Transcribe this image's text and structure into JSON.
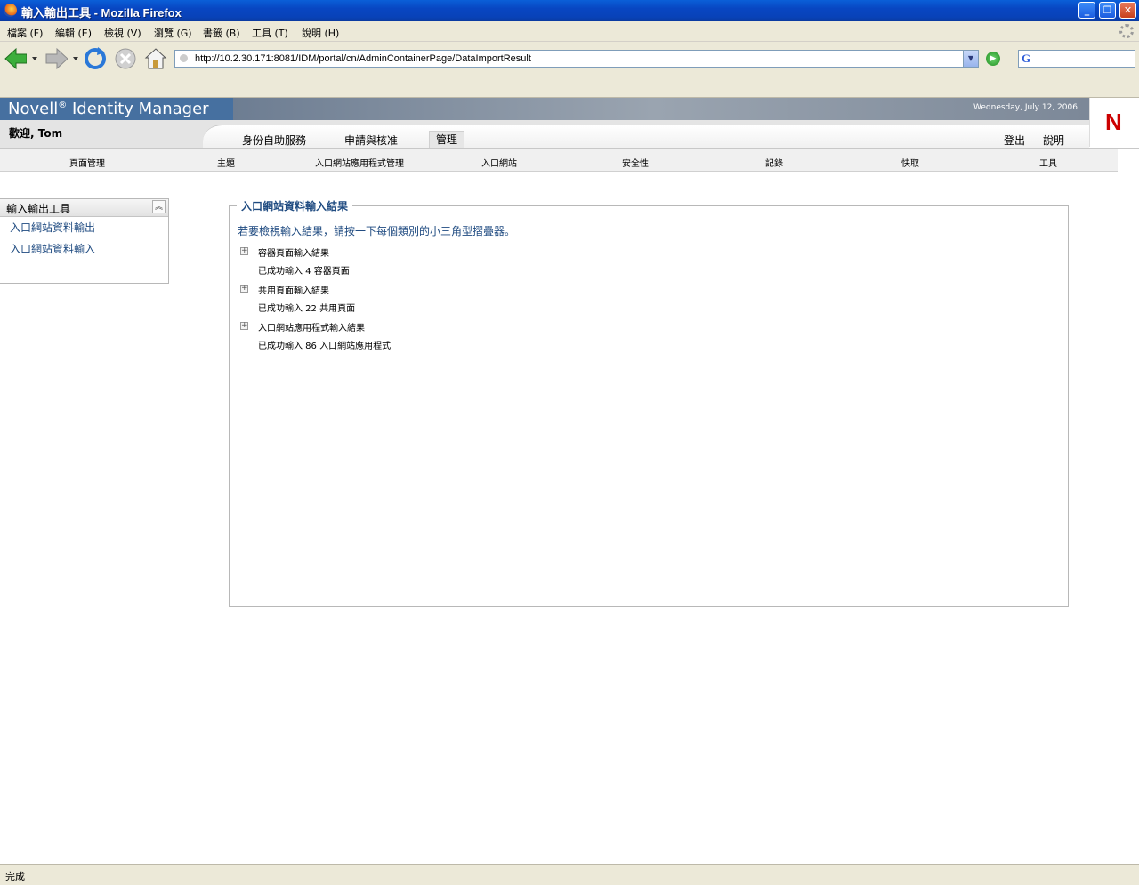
{
  "window": {
    "title": "輸入輸出工具 - Mozilla Firefox",
    "minimize": "_",
    "maximize": "❐",
    "close": "✕"
  },
  "menu": [
    "檔案 (F)",
    "編輯 (E)",
    "檢視 (V)",
    "瀏覽 (G)",
    "書籤 (B)",
    "工具 (T)",
    "說明 (H)"
  ],
  "toolbar": {
    "url": "http://10.2.30.171:8081/IDM/portal/cn/AdminContainerPage/DataImportResult",
    "url_dropdown": "▼",
    "go": "▶",
    "search_engine": "G"
  },
  "header": {
    "brand": "Novell",
    "brand_mark": "®",
    "product": "Identity Manager",
    "date": "Wednesday, July 12, 2006",
    "logo": "N",
    "welcome": "歡迎, Tom",
    "tabs": [
      "身份自助服務",
      "申請與核准",
      "管理"
    ],
    "active_tab": "管理",
    "logout": "登出",
    "help": "說明"
  },
  "subnav": [
    "頁面管理",
    "主題",
    "入口網站應用程式管理",
    "入口網站",
    "安全性",
    "記錄",
    "快取",
    "工具"
  ],
  "left_panel": {
    "title": "輸入輸出工具",
    "collapse": "︽",
    "links": [
      "入口網站資料輸出",
      "入口網站資料輸入"
    ]
  },
  "main": {
    "legend": "入口網站資料輸入結果",
    "instruction": "若要檢視輸入結果，請按一下每個類別的小三角型摺疊器。",
    "expand_glyph": "+",
    "results": [
      {
        "title": "容器頁面輸入結果",
        "detail": "已成功輸入 4 容器頁面"
      },
      {
        "title": "共用頁面輸入結果",
        "detail": "已成功輸入 22 共用頁面"
      },
      {
        "title": "入口網站應用程式輸入結果",
        "detail": "已成功輸入 86 入口網站應用程式"
      }
    ]
  },
  "status": {
    "text": "完成"
  }
}
